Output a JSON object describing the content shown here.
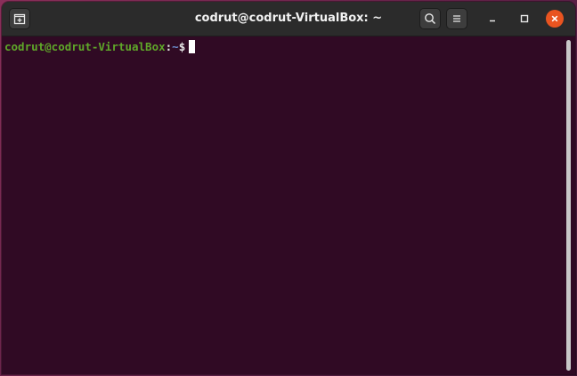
{
  "window": {
    "title": "codrut@codrut-VirtualBox: ~"
  },
  "titlebar": {
    "new_tab_icon": "new-tab-icon",
    "search_icon": "search-icon",
    "menu_icon": "hamburger-menu-icon",
    "minimize_icon": "minimize-icon",
    "maximize_icon": "maximize-icon",
    "close_icon": "close-icon"
  },
  "terminal": {
    "prompt": {
      "user_host": "codrut@codrut-VirtualBox",
      "colon": ":",
      "cwd": "~",
      "dollar": "$"
    }
  },
  "colors": {
    "terminal_bg": "#300a24",
    "titlebar_bg": "#2b2b2b",
    "close_button": "#e95420",
    "prompt_user_host": "#5fa729",
    "prompt_cwd": "#6d8fd0"
  }
}
